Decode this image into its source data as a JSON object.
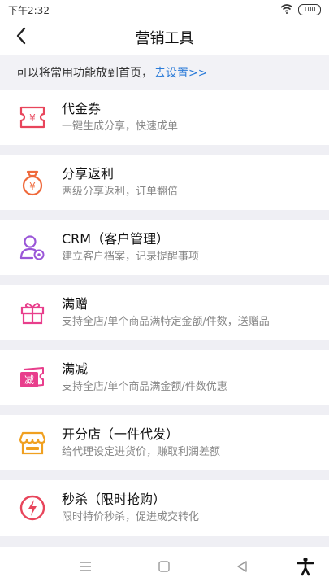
{
  "status_bar": {
    "time": "下午2:32",
    "battery": "100",
    "icons": [
      "wifi-icon",
      "battery-icon"
    ]
  },
  "header": {
    "title": "营销工具",
    "back_icon": "chevron-left-icon"
  },
  "tip": {
    "text": "可以将常用功能放到首页，",
    "link": "去设置>>",
    "link_color": "#2b7bd8"
  },
  "tools": [
    {
      "title": "代金券",
      "desc": "一键生成分享，快速成单",
      "icon": "voucher-icon",
      "color": "#e8455b"
    },
    {
      "title": "分享返利",
      "desc": "两级分享返利，订单翻倍",
      "icon": "money-bag-icon",
      "color": "#ef6a3c"
    },
    {
      "title": "CRM（客户管理）",
      "desc": "建立客户档案，记录提醒事项",
      "icon": "user-settings-icon",
      "color": "#9a56d8"
    },
    {
      "title": "满赠",
      "desc": "支持全店/单个商品满特定金额/件数，送赠品",
      "icon": "gift-icon",
      "color": "#e83e8c"
    },
    {
      "title": "满减",
      "desc": "支持全店/单个商品满金额/件数优惠",
      "icon": "discount-ticket-icon",
      "color": "#e83e8c",
      "badge": "减"
    },
    {
      "title": "开分店（一件代发）",
      "desc": "给代理设定进货价，赚取利润差额",
      "icon": "store-icon",
      "color": "#f0a020"
    },
    {
      "title": "秒杀（限时抢购）",
      "desc": "限时特价秒杀，促进成交转化",
      "icon": "lightning-icon",
      "color": "#e8455b"
    }
  ],
  "system_nav": {
    "icons": [
      "menu-icon",
      "home-square-icon",
      "back-triangle-icon",
      "accessibility-icon"
    ]
  }
}
